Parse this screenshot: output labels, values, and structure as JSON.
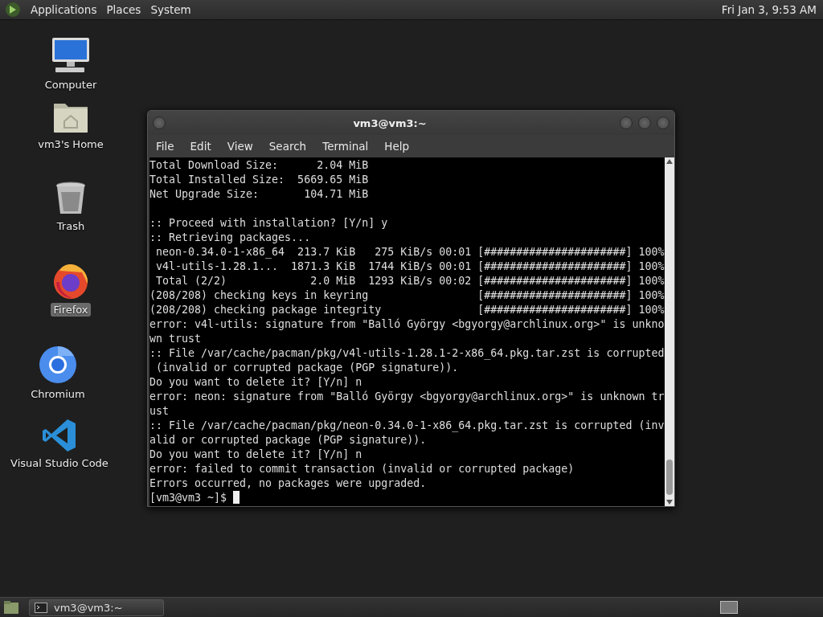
{
  "top_panel": {
    "menus": [
      "Applications",
      "Places",
      "System"
    ],
    "clock": "Fri Jan 3, 9:53 AM"
  },
  "desktop_icons": [
    {
      "kind": "computer",
      "label": "Computer",
      "selected": false
    },
    {
      "kind": "home",
      "label": "vm3's Home",
      "selected": false
    },
    {
      "kind": "trash",
      "label": "Trash",
      "selected": false
    },
    {
      "kind": "firefox",
      "label": "Firefox",
      "selected": true
    },
    {
      "kind": "chromium",
      "label": "Chromium",
      "selected": false
    },
    {
      "kind": "vscode",
      "label": "Visual Studio Code",
      "selected": false
    }
  ],
  "terminal_window": {
    "title": "vm3@vm3:~",
    "menus": [
      "File",
      "Edit",
      "View",
      "Search",
      "Terminal",
      "Help"
    ],
    "blocks": [
      [
        "Total Download Size:      2.04 MiB",
        "Total Installed Size:  5669.65 MiB",
        "Net Upgrade Size:       104.71 MiB"
      ],
      [
        ":: Proceed with installation? [Y/n] y",
        ":: Retrieving packages...",
        " neon-0.34.0-1-x86_64  213.7 KiB   275 KiB/s 00:01 [######################] 100%",
        " v4l-utils-1.28.1...  1871.3 KiB  1744 KiB/s 00:01 [######################] 100%",
        " Total (2/2)             2.0 MiB  1293 KiB/s 00:02 [######################] 100%",
        "(208/208) checking keys in keyring                 [######################] 100%",
        "(208/208) checking package integrity               [######################] 100%",
        "error: v4l-utils: signature from \"Balló György <bgyorgy@archlinux.org>\" is unkno",
        "wn trust",
        ":: File /var/cache/pacman/pkg/v4l-utils-1.28.1-2-x86_64.pkg.tar.zst is corrupted",
        " (invalid or corrupted package (PGP signature)).",
        "Do you want to delete it? [Y/n] n",
        "error: neon: signature from \"Balló György <bgyorgy@archlinux.org>\" is unknown tr",
        "ust",
        ":: File /var/cache/pacman/pkg/neon-0.34.0-1-x86_64.pkg.tar.zst is corrupted (inv",
        "alid or corrupted package (PGP signature)).",
        "Do you want to delete it? [Y/n] n",
        "error: failed to commit transaction (invalid or corrupted package)",
        "Errors occurred, no packages were upgraded."
      ]
    ],
    "prompt": "[vm3@vm3 ~]$"
  },
  "bottom_panel": {
    "tasks": [
      {
        "label": "vm3@vm3:~",
        "selected": false
      }
    ]
  }
}
